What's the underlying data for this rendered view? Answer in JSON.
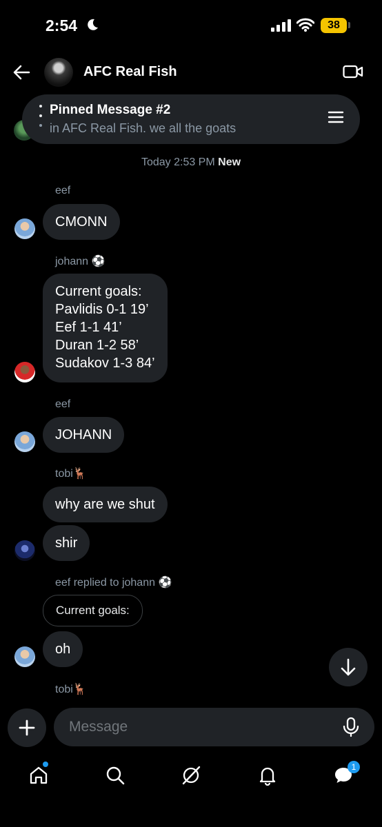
{
  "status_bar": {
    "time": "2:54",
    "battery": "38"
  },
  "header": {
    "title": "AFC Real Fish"
  },
  "pinned": {
    "title": "Pinned Message #2",
    "text": "in AFC Real Fish. we all the goats"
  },
  "timestamp": {
    "time": "Today 2:53 PM",
    "tag": "New"
  },
  "messages": [
    {
      "sender": "eef",
      "text": "CMONN"
    },
    {
      "sender": "johann ⚽",
      "lines": [
        "Current goals:",
        "Pavlidis 0-1 19’",
        "Eef 1-1 41’",
        "Duran 1-2 58’",
        "Sudakov 1-3 84’"
      ]
    },
    {
      "sender": "eef",
      "text": "JOHANN"
    },
    {
      "sender": "tobi🦌",
      "texts": [
        "why are we shut",
        "shir"
      ]
    },
    {
      "sender": "eef replied to johann ⚽",
      "quoted": "Current goals:",
      "text": "oh"
    },
    {
      "sender": "tobi🦌"
    }
  ],
  "composer": {
    "placeholder": "Message"
  },
  "nav": {
    "messages_badge": "1"
  },
  "icons": [
    "back-arrow-icon",
    "video-icon",
    "menu-icon",
    "arrow-down-icon",
    "plus-icon",
    "mic-icon",
    "home-icon",
    "search-icon",
    "grok-icon",
    "bell-icon",
    "messages-icon"
  ],
  "colors": {
    "background": "#000000",
    "bubble": "#202327",
    "accent": "#1d9bf0",
    "secondary_text": "#8b98a5",
    "battery": "#f5c400"
  }
}
